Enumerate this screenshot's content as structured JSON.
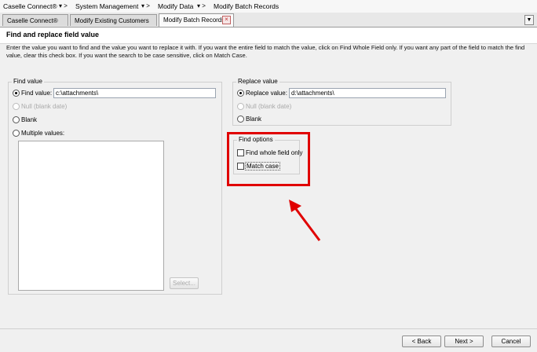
{
  "breadcrumb": [
    "Caselle Connect®",
    "System Management",
    "Modify Data",
    "Modify Batch Records"
  ],
  "breadcrumb_separators": [
    "▾ >",
    "▾ >",
    "▾ >"
  ],
  "tabs": [
    {
      "label": "Caselle Connect®",
      "active": false
    },
    {
      "label": "Modify Existing Customers",
      "active": false
    },
    {
      "label": "Modify Batch Records",
      "active": true
    }
  ],
  "header": {
    "title": "Find and replace field value"
  },
  "instructions": "Enter the value you want to find and the value you want to replace it with.  If you want the entire field to match the value, click on Find Whole Field only.  If you want any part of the field to match the find value, clear this check box.  If you want the search to be case sensitive, click on Match Case.",
  "find_group": {
    "title": "Find value",
    "find_value_label": "Find value:",
    "find_value": "c:\\attachments\\",
    "null_label": "Null (blank date)",
    "blank_label": "Blank",
    "multiple_label": "Multiple values:",
    "select_button": "Select...",
    "selected_option": "Find value"
  },
  "replace_group": {
    "title": "Replace value",
    "replace_value_label": "Replace value:",
    "replace_value": "d:\\attachments\\",
    "null_label": "Null (blank date)",
    "blank_label": "Blank",
    "selected_option": "Replace value"
  },
  "find_options": {
    "title": "Find options",
    "whole_field_label": "Find whole field only",
    "whole_field_checked": false,
    "match_case_label": "Match case",
    "match_case_checked": false
  },
  "footer": {
    "back": "< Back",
    "next": "Next >",
    "cancel": "Cancel"
  },
  "annotation": {
    "highlight_color": "#e00000",
    "arrow_color": "#e00000"
  }
}
